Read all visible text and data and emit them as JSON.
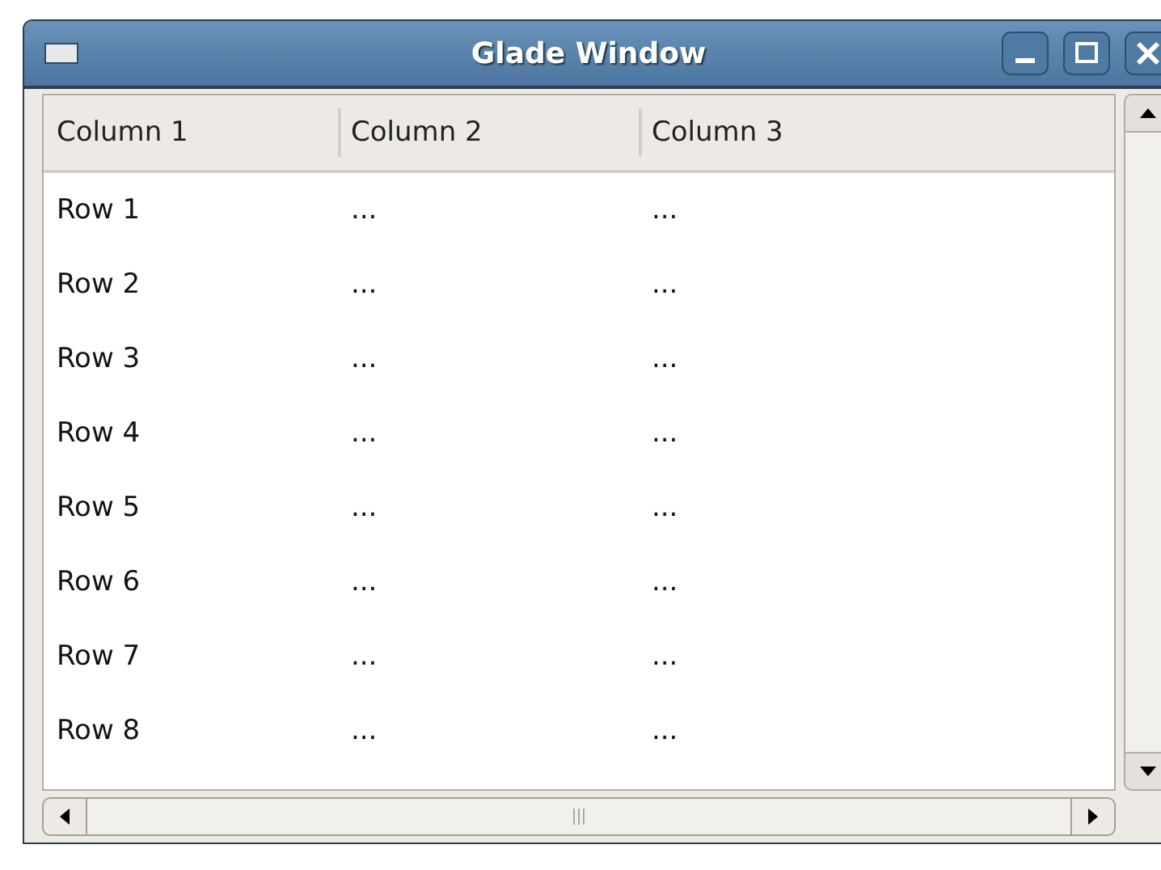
{
  "window": {
    "title": "Glade Window"
  },
  "table": {
    "columns": [
      "Column 1",
      "Column 2",
      "Column 3"
    ],
    "rows": [
      [
        "Row 1",
        "...",
        "..."
      ],
      [
        "Row 2",
        "...",
        "..."
      ],
      [
        "Row 3",
        "...",
        "..."
      ],
      [
        "Row 4",
        "...",
        "..."
      ],
      [
        "Row 5",
        "...",
        "..."
      ],
      [
        "Row 6",
        "...",
        "..."
      ],
      [
        "Row 7",
        "...",
        "..."
      ],
      [
        "Row 8",
        "...",
        "..."
      ]
    ]
  }
}
